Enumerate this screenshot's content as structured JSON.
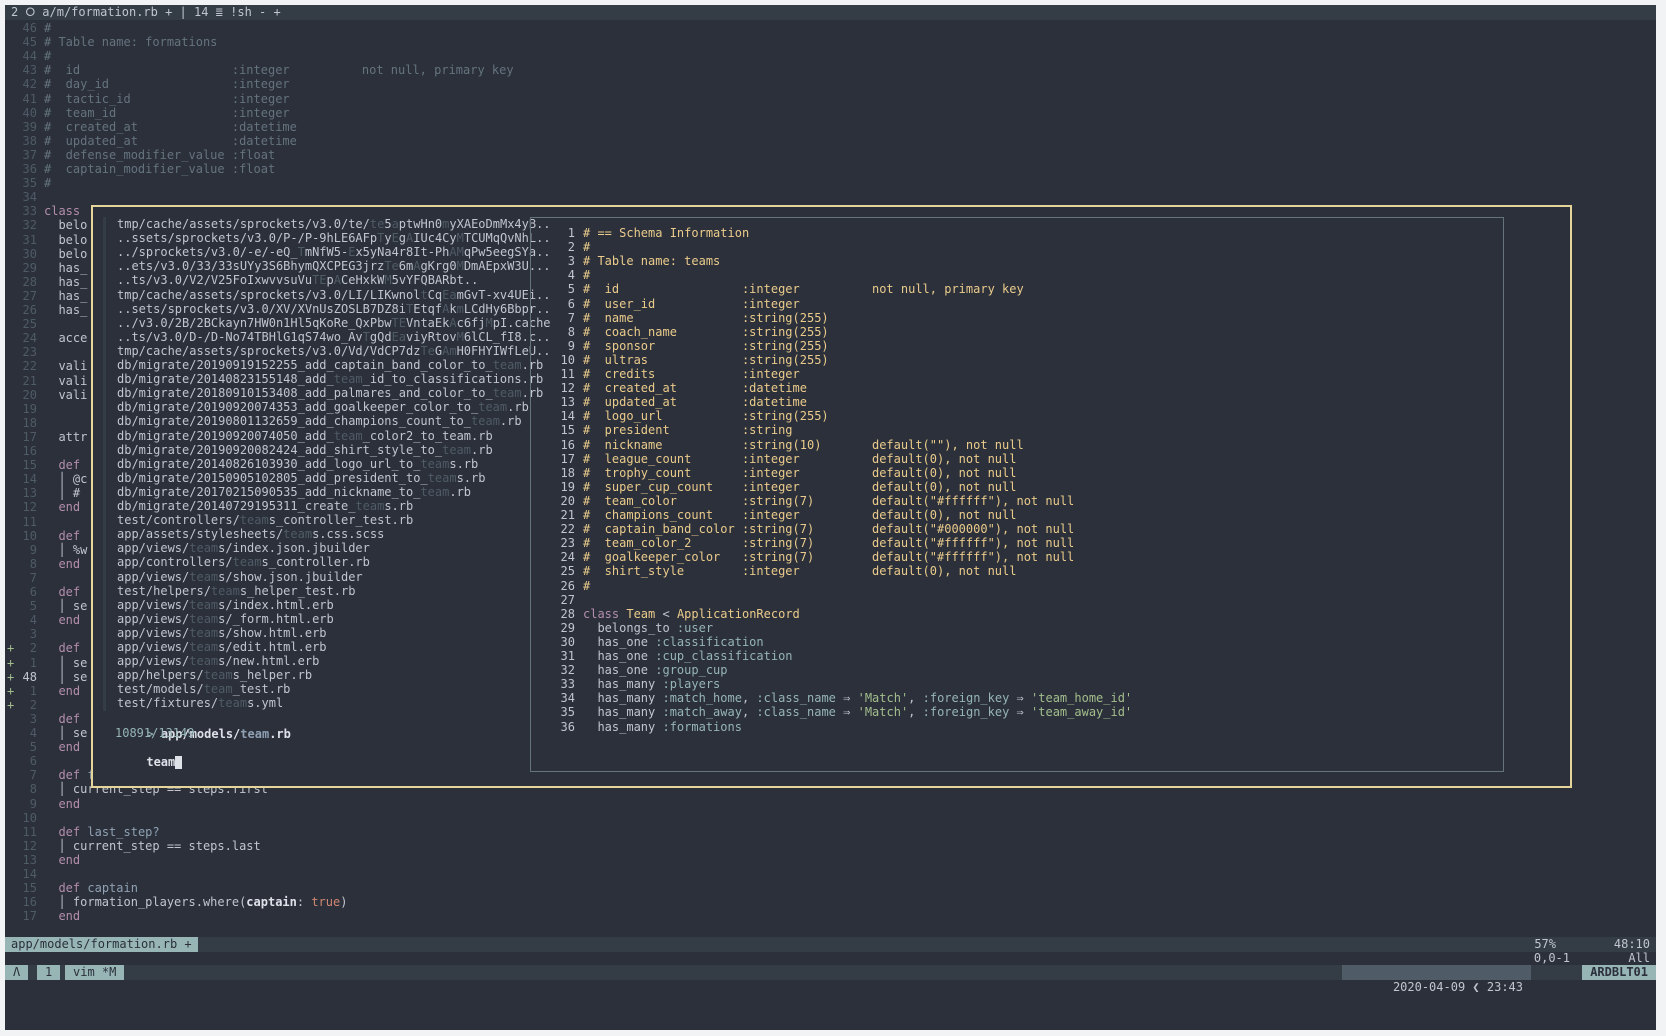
{
  "tabline": "2 ⭘ a/m/formation.rb + | 14 ≣ !sh - +",
  "code_top": [
    {
      "n": "46",
      "html": "<span class=\"cm\">#</span>"
    },
    {
      "n": "45",
      "html": "<span class=\"cm\"># Table name: formations</span>"
    },
    {
      "n": "44",
      "html": "<span class=\"cm\">#</span>"
    },
    {
      "n": "43",
      "html": "<span class=\"cm\">#  id                     :integer          not null, primary key</span>"
    },
    {
      "n": "42",
      "html": "<span class=\"cm\">#  day_id                 :integer</span>"
    },
    {
      "n": "41",
      "html": "<span class=\"cm\">#  tactic_id              :integer</span>"
    },
    {
      "n": "40",
      "html": "<span class=\"cm\">#  team_id                :integer</span>"
    },
    {
      "n": "39",
      "html": "<span class=\"cm\">#  created_at             :datetime</span>"
    },
    {
      "n": "38",
      "html": "<span class=\"cm\">#  updated_at             :datetime</span>"
    },
    {
      "n": "37",
      "html": "<span class=\"cm\">#  defense_modifier_value :float</span>"
    },
    {
      "n": "36",
      "html": "<span class=\"cm\">#  captain_modifier_value :float</span>"
    },
    {
      "n": "35",
      "html": "<span class=\"cm\">#</span>"
    },
    {
      "n": "34",
      "html": ""
    }
  ],
  "code_left": [
    {
      "n": "33",
      "t": "class",
      "c": "kw"
    },
    {
      "n": "32",
      "t": "  belo"
    },
    {
      "n": "31",
      "t": "  belo"
    },
    {
      "n": "30",
      "t": "  belo"
    },
    {
      "n": "29",
      "t": "  has_"
    },
    {
      "n": "28",
      "t": "  has_"
    },
    {
      "n": "27",
      "t": "  has_"
    },
    {
      "n": "26",
      "t": "  has_"
    },
    {
      "n": "25",
      "t": ""
    },
    {
      "n": "24",
      "t": "  acce"
    },
    {
      "n": "23",
      "t": ""
    },
    {
      "n": "22",
      "t": "  vali"
    },
    {
      "n": "21",
      "t": "  vali"
    },
    {
      "n": "20",
      "t": "  vali"
    },
    {
      "n": "19",
      "t": ""
    },
    {
      "n": "18",
      "t": ""
    },
    {
      "n": "17",
      "t": "  attr"
    },
    {
      "n": "16",
      "t": ""
    },
    {
      "n": "15",
      "t": "  def",
      "c": "kw"
    },
    {
      "n": "14",
      "t": "  │ @c"
    },
    {
      "n": "13",
      "t": "  │ #"
    },
    {
      "n": "12",
      "t": "  end",
      "c": "kw"
    },
    {
      "n": "11",
      "t": ""
    },
    {
      "n": "10",
      "t": "  def",
      "c": "kw"
    },
    {
      "n": "9",
      "t": "  │ %w"
    },
    {
      "n": "8",
      "t": "  end",
      "c": "kw"
    },
    {
      "n": "7",
      "t": ""
    },
    {
      "n": "6",
      "t": "  def",
      "c": "kw"
    },
    {
      "n": "5",
      "t": "  │ se"
    },
    {
      "n": "4",
      "t": "  end",
      "c": "kw"
    },
    {
      "n": "3",
      "t": ""
    },
    {
      "n": "2",
      "t": "  def",
      "c": "kw",
      "plus": true
    },
    {
      "n": "1",
      "t": "  │ se",
      "plus": true
    },
    {
      "n": "48",
      "t": "  │ se",
      "plus": true,
      "cur": true
    },
    {
      "n": "1",
      "t": "  end",
      "c": "kw",
      "plus": true
    },
    {
      "n": "2",
      "t": "",
      "plus": true
    },
    {
      "n": "3",
      "t": "  def",
      "c": "kw"
    },
    {
      "n": "4",
      "t": "  │ se"
    },
    {
      "n": "5",
      "t": "  end",
      "c": "kw"
    }
  ],
  "code_bottom": [
    {
      "n": "6",
      "html": ""
    },
    {
      "n": "7",
      "html": "  <span class=\"kw\">def</span> <span class=\"fn\">first_step?</span>"
    },
    {
      "n": "8",
      "html": "  │ current_step == steps.first"
    },
    {
      "n": "9",
      "html": "  <span class=\"kw\">end</span>"
    },
    {
      "n": "10",
      "html": ""
    },
    {
      "n": "11",
      "html": "  <span class=\"kw\">def</span> <span class=\"fn\">last_step?</span>"
    },
    {
      "n": "12",
      "html": "  │ current_step == steps.last"
    },
    {
      "n": "13",
      "html": "  <span class=\"kw\">end</span>"
    },
    {
      "n": "14",
      "html": ""
    },
    {
      "n": "15",
      "html": "  <span class=\"kw\">def</span> <span class=\"fn\">captain</span>"
    },
    {
      "n": "16",
      "html": "  │ formation_players.where(<span class=\"bold\">captain</span>: <span class=\"bool\">true</span>)"
    },
    {
      "n": "17",
      "html": "  <span class=\"kw\">end</span>"
    }
  ],
  "finder": {
    "files": [
      "tmp/cache/assets/sprockets/v3.0/te/<span class=\"m\">te</span>5<span class=\"m\">a</span>ptwHn0<span class=\"m\">m</span>yXAEoDmMx4yB..",
      "..ssets/sprockets/v3.0/P-/P-9hLE6AFp<span class=\"m\">T</span>y<span class=\"m\">E</span>g<span class=\"m\">A</span>IUc4Cy<span class=\"m\">M</span>TCUMqQvNhL..",
      "../sprockets/v3.0/-e/-eQ_<span class=\"m\">T</span>mNfW5-<span class=\"m\">E</span>x5yNa4r8It-Ph<span class=\"m\">AM</span>qPw5eegSYa..",
      "..ets/v3.0/33/33sUYy3S6BhymQXCPEG3jrz<span class=\"m\">Te</span>6m<span class=\"m\">A</span>gKrg0<span class=\"m\">M</span>DmAEpxW3U...",
      "..ts/v3.0/V2/V25FoIxwvvsuVu<span class=\"m\">TE</span>p<span class=\"m\">A</span>CeHxkW<span class=\"m\">M</span>5vYFQBARbt..",
      "tmp/cache/assets/sprockets/v3.0/LI/LIKwnol<span class=\"m\">t</span>Cq<span class=\"m\">Ea</span>m<span class=\"m\"></span>GvT-xv4UEi..",
      "..sets/sprockets/v3.0/XV/XVnUsZOSLB7DZ8i<span class=\"m\">T</span>E<span class=\"m\"></span>tqf<span class=\"m\">A</span>k<span class=\"m\">m</span>LCdHy6Bbpr..",
      "../v3.0/2B/2BCkayn7HW0n1Hl5qKoRe_QxPbw<span class=\"m\">TE</span>VntaEk<span class=\"m\">A</span>c6fj<span class=\"m\">M</span>pI.cache",
      "..ts/v3.0/D-/D-No74TBHlG1qS74wo_Av<span class=\"m\">T</span>gQd<span class=\"m\">Ea</span>viyRtov<span class=\"m\">M</span>6lCL_fI8.c..",
      "tmp/cache/assets/sprockets/v3.0/Vd/VdCP7dz<span class=\"m\">Te</span>G<span class=\"m\">Am</span>H0FHYIWfLeU..",
      "db/migrate/20190919152255_add_captain_band_color_to_<span class=\"q\">team</span>.rb",
      "db/migrate/20140823155148_add_<span class=\"q\">team</span>_id_to_classifications.rb",
      "db/migrate/20180910153408_add_palmares_and_color_to_<span class=\"q\">team</span>.rb",
      "db/migrate/20190920074353_add_goalkeeper_color_to_<span class=\"q\">team</span>.rb",
      "db/migrate/20190801132659_add_champions_count_to_<span class=\"q\">team</span>.rb",
      "db/migrate/20190920074050_add_<span class=\"q\">team</span>_color2_to_team.rb",
      "db/migrate/20190920082424_add_shirt_style_to_<span class=\"q\">team</span>.rb",
      "db/migrate/20140826103930_add_logo_url_to_<span class=\"q\">team</span>s.rb",
      "db/migrate/20150905102805_add_president_to_<span class=\"q\">team</span>s.rb",
      "db/migrate/20170215090535_add_nickname_to_<span class=\"q\">team</span>.rb",
      "db/migrate/20140729195311_create_<span class=\"q\">team</span>s.rb",
      "test/controllers/<span class=\"q\">team</span>s_controller_test.rb",
      "app/assets/stylesheets/<span class=\"q\">team</span>s.css.scss",
      "app/views/<span class=\"q\">team</span>s/index.json.jbuilder",
      "app/controllers/<span class=\"q\">team</span>s_controller.rb",
      "app/views/<span class=\"q\">team</span>s/show.json.jbuilder",
      "test/helpers/<span class=\"q\">team</span>s_helper_test.rb",
      "app/views/<span class=\"q\">team</span>s/index.html.erb",
      "app/views/<span class=\"q\">team</span>s/_form.html.erb",
      "app/views/<span class=\"q\">team</span>s/show.html.erb",
      "app/views/<span class=\"q\">team</span>s/edit.html.erb",
      "app/views/<span class=\"q\">team</span>s/new.html.erb",
      "app/helpers/<span class=\"q\">team</span>s_helper.rb",
      "test/models/<span class=\"q\">team</span>_test.rb",
      "test/fixtures/<span class=\"q\">team</span>s.yml"
    ],
    "selected": "app/models/team.rb",
    "selected_html": "<span class=\"bold\">app/models/</span><span class=\"q\" style=\"color:#8fa1b3;font-weight:bold\">team</span><span class=\"bold\">.rb</span>",
    "count": "10891/13149",
    "query": "team"
  },
  "preview": [
    {
      "n": "1",
      "html": "<span class=\"cls\"># == Schema Information</span>"
    },
    {
      "n": "2",
      "html": "<span class=\"cls\">#</span>"
    },
    {
      "n": "3",
      "html": "<span class=\"cls\"># Table name: teams</span>"
    },
    {
      "n": "4",
      "html": "<span class=\"cls\">#</span>"
    },
    {
      "n": "5",
      "html": "<span class=\"cls\">#  id                 :integer          not null, primary key</span>"
    },
    {
      "n": "6",
      "html": "<span class=\"cls\">#  user_id            :integer</span>"
    },
    {
      "n": "7",
      "html": "<span class=\"cls\">#  name               :string(255)</span>"
    },
    {
      "n": "8",
      "html": "<span class=\"cls\">#  coach_name         :string(255)</span>"
    },
    {
      "n": "9",
      "html": "<span class=\"cls\">#  sponsor            :string(255)</span>"
    },
    {
      "n": "10",
      "html": "<span class=\"cls\">#  ultras             :string(255)</span>"
    },
    {
      "n": "11",
      "html": "<span class=\"cls\">#  credits            :integer</span>"
    },
    {
      "n": "12",
      "html": "<span class=\"cls\">#  created_at         :datetime</span>"
    },
    {
      "n": "13",
      "html": "<span class=\"cls\">#  updated_at         :datetime</span>"
    },
    {
      "n": "14",
      "html": "<span class=\"cls\">#  logo_url           :string(255)</span>"
    },
    {
      "n": "15",
      "html": "<span class=\"cls\">#  president          :string</span>"
    },
    {
      "n": "16",
      "html": "<span class=\"cls\">#  nickname           :string(10)       default(\"\"), not null</span>"
    },
    {
      "n": "17",
      "html": "<span class=\"cls\">#  league_count       :integer          default(0), not null</span>"
    },
    {
      "n": "18",
      "html": "<span class=\"cls\">#  trophy_count       :integer          default(0), not null</span>"
    },
    {
      "n": "19",
      "html": "<span class=\"cls\">#  super_cup_count    :integer          default(0), not null</span>"
    },
    {
      "n": "20",
      "html": "<span class=\"cls\">#  team_color         :string(7)        default(\"#ffffff\"), not null</span>"
    },
    {
      "n": "21",
      "html": "<span class=\"cls\">#  champions_count    :integer          default(0), not null</span>"
    },
    {
      "n": "22",
      "html": "<span class=\"cls\">#  captain_band_color :string(7)        default(\"#000000\"), not null</span>"
    },
    {
      "n": "23",
      "html": "<span class=\"cls\">#  team_color_2       :string(7)        default(\"#ffffff\"), not null</span>"
    },
    {
      "n": "24",
      "html": "<span class=\"cls\">#  goalkeeper_color   :string(7)        default(\"#ffffff\"), not null</span>"
    },
    {
      "n": "25",
      "html": "<span class=\"cls\">#  shirt_style        :integer          default(0), not null</span>"
    },
    {
      "n": "26",
      "html": "<span class=\"cls\">#</span>"
    },
    {
      "n": "27",
      "html": ""
    },
    {
      "n": "28",
      "html": "<span class=\"kw\">class</span> <span class=\"cls\">Team</span> &lt; <span class=\"cls\">ApplicationRecord</span>"
    },
    {
      "n": "29",
      "html": "  belongs_to <span class=\"sym\">:user</span>"
    },
    {
      "n": "30",
      "html": "  has_one <span class=\"sym\">:classification</span>"
    },
    {
      "n": "31",
      "html": "  has_one <span class=\"sym\">:cup_classification</span>"
    },
    {
      "n": "32",
      "html": "  has_one <span class=\"sym\">:group_cup</span>"
    },
    {
      "n": "33",
      "html": "  has_many <span class=\"sym\">:players</span>"
    },
    {
      "n": "34",
      "html": "  has_many <span class=\"sym\">:match_home</span>, <span class=\"sym\">:class_name</span> ⇒ <span class=\"str\">'Match'</span>, <span class=\"sym\">:foreign_key</span> ⇒ <span class=\"str\">'team_home_id'</span>"
    },
    {
      "n": "35",
      "html": "  has_many <span class=\"sym\">:match_away</span>, <span class=\"sym\">:class_name</span> ⇒ <span class=\"str\">'Match'</span>, <span class=\"sym\">:foreign_key</span> ⇒ <span class=\"str\">'team_away_id'</span>"
    },
    {
      "n": "36",
      "html": "  has_many <span class=\"sym\">:formations</span>"
    }
  ],
  "statusline": {
    "filename": "app/models/formation.rb +",
    "percent": "57%",
    "position": "48:10",
    "cursor_pos": "0,0-1",
    "scroll": "All"
  },
  "tmux": {
    "mode": "Λ",
    "window": "1",
    "name": "vim *M",
    "date": "2020-04-09",
    "time": "23:43",
    "host": "ARDBLT01"
  }
}
